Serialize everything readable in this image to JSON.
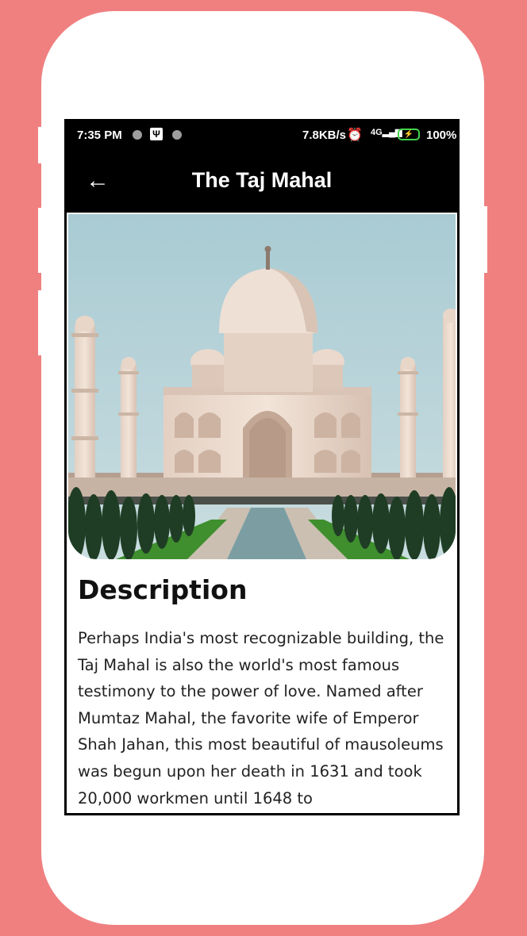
{
  "status_bar": {
    "time": "7:35 PM",
    "net_speed": "7.8KB/s",
    "network": "4G",
    "battery_percent": "100%"
  },
  "app_bar": {
    "title": "The Taj Mahal",
    "back_icon": "arrow-left-icon"
  },
  "hero_image": {
    "subject": "Taj Mahal photo"
  },
  "description": {
    "heading": "Description",
    "body": "Perhaps India's most recognizable building, the Taj Mahal is also the world's most famous testimony to the power of love. Named after Mumtaz Mahal, the favorite wife of Emperor Shah Jahan, this most beautiful of mausoleums was begun upon her death in 1631 and took 20,000 workmen until 1648 to"
  },
  "colors": {
    "background": "#f08080",
    "phone": "#ffffff",
    "app_bar": "#000000",
    "battery": "#43d34d"
  }
}
